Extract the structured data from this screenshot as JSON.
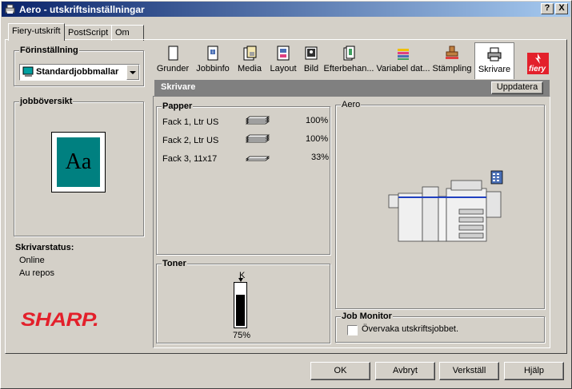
{
  "window": {
    "title": "Aero - utskriftsinställningar",
    "help_button": "?",
    "close_button": "X"
  },
  "tabs": [
    {
      "label": "Fiery-utskrift",
      "active": true
    },
    {
      "label": "PostScript",
      "active": false
    },
    {
      "label": "Om",
      "active": false
    }
  ],
  "preset": {
    "group_label": "Förinställning",
    "selected": "Standardjobbmallar"
  },
  "job_overview": {
    "group_label": "jobböversikt",
    "preview_text": "Aa"
  },
  "printer_status": {
    "label": "Skrivarstatus:",
    "lines": [
      "Online",
      "Au repos"
    ]
  },
  "brand": {
    "sharp": "SHARP.",
    "fiery": "fiery",
    "sharp_color": "#e3202b",
    "fiery_color": "#e3202b"
  },
  "toolbar": [
    {
      "label": "Grunder",
      "icon": "document-icon"
    },
    {
      "label": "Jobbinfo",
      "icon": "info-icon"
    },
    {
      "label": "Media",
      "icon": "media-icon"
    },
    {
      "label": "Layout",
      "icon": "layout-icon"
    },
    {
      "label": "Bild",
      "icon": "image-icon"
    },
    {
      "label": "Efterbehan...",
      "icon": "finishing-icon"
    },
    {
      "label": "Variabel dat...",
      "icon": "variable-data-icon"
    },
    {
      "label": "Stämpling",
      "icon": "stamp-icon"
    },
    {
      "label": "Skrivare",
      "icon": "printer-icon",
      "active": true
    }
  ],
  "section": {
    "title": "Skrivare",
    "update_button": "Uppdatera"
  },
  "paper": {
    "group_label": "Papper",
    "trays": [
      {
        "name": "Fack 1, Ltr US",
        "level": "100%"
      },
      {
        "name": "Fack 2, Ltr US",
        "level": "100%"
      },
      {
        "name": "Fack 3, 11x17",
        "level": "33%"
      }
    ]
  },
  "toner": {
    "group_label": "Toner",
    "color_label": "K",
    "level": "75%",
    "fill_fraction": 0.75
  },
  "device": {
    "group_label": "Aero"
  },
  "job_monitor": {
    "group_label": "Job Monitor",
    "checkbox_label": "Övervaka utskriftsjobbet.",
    "checked": false
  },
  "footer": {
    "ok": "OK",
    "cancel": "Avbryt",
    "apply": "Verkställ",
    "help": "Hjälp"
  }
}
